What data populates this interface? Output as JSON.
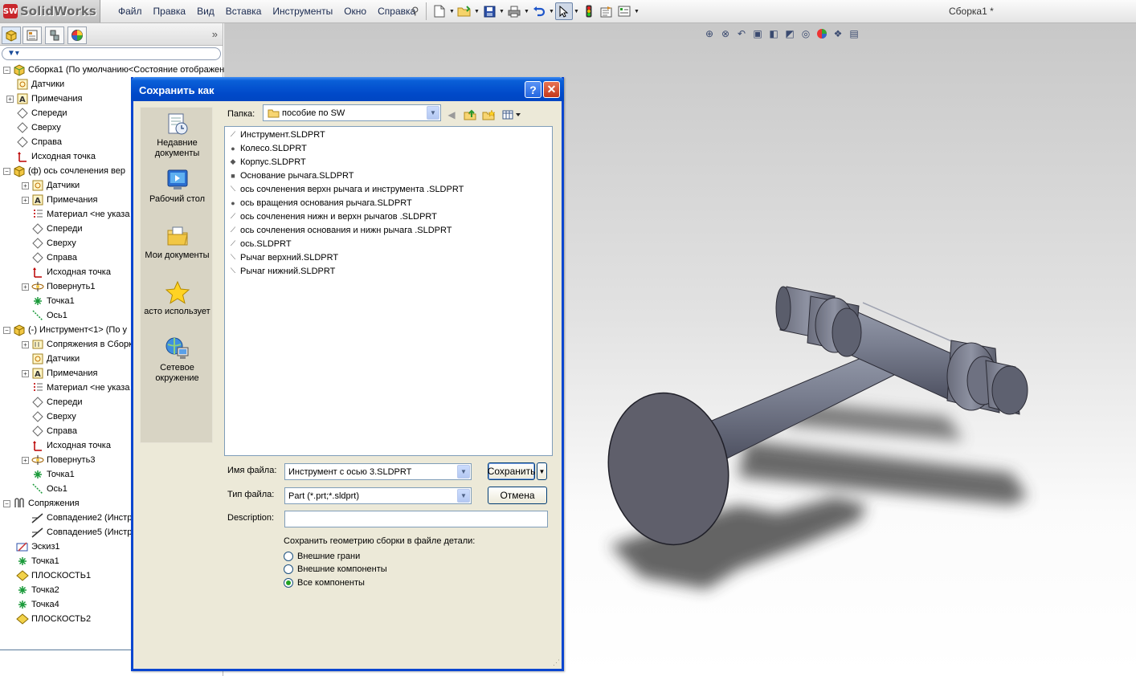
{
  "app": {
    "name": "SolidWorks",
    "logo_mark": "SW",
    "document_title": "Сборка1 *"
  },
  "menu": [
    "Файл",
    "Правка",
    "Вид",
    "Вставка",
    "Инструменты",
    "Окно",
    "Справка"
  ],
  "toolbar_icons": [
    "new-icon",
    "open-icon",
    "save-icon",
    "print-icon",
    "undo-icon",
    "select-icon",
    "rebuild-icon",
    "options-icon",
    "customize-icon"
  ],
  "view_toolbar_icons": [
    "zoom-to-fit-icon",
    "zoom-area-icon",
    "previous-view-icon",
    "section-view-icon",
    "view-orientation-icon",
    "display-style-icon",
    "hide-show-icon",
    "appearance-icon",
    "scene-icon",
    "view-settings-icon"
  ],
  "feature_tree": {
    "items": [
      {
        "label": "Сборка1  (По умолчанию<Состояние отображени",
        "icon": "assembly-icon"
      },
      {
        "label": "Датчики",
        "icon": "sensor-icon"
      },
      {
        "label": "Примечания",
        "icon": "annotation-icon"
      },
      {
        "label": "Спереди",
        "icon": "plane-icon"
      },
      {
        "label": "Сверху",
        "icon": "plane-icon"
      },
      {
        "label": "Справа",
        "icon": "plane-icon"
      },
      {
        "label": "Исходная точка",
        "icon": "origin-icon"
      },
      {
        "label": "(ф) ось  сочленения вер",
        "icon": "part-icon"
      },
      {
        "label": "Датчики",
        "icon": "sensor-icon"
      },
      {
        "label": "Примечания",
        "icon": "annotation-icon"
      },
      {
        "label": "Материал <не указа",
        "icon": "material-icon"
      },
      {
        "label": "Спереди",
        "icon": "plane-icon"
      },
      {
        "label": "Сверху",
        "icon": "plane-icon"
      },
      {
        "label": "Справа",
        "icon": "plane-icon"
      },
      {
        "label": "Исходная точка",
        "icon": "origin-icon"
      },
      {
        "label": "Повернуть1",
        "icon": "revolve-icon"
      },
      {
        "label": "Точка1",
        "icon": "point-icon"
      },
      {
        "label": "Ось1",
        "icon": "axis-icon"
      },
      {
        "label": "(-) Инструмент<1> (По у",
        "icon": "part-icon"
      },
      {
        "label": "Сопряжения в Сборк",
        "icon": "mates-folder-icon"
      },
      {
        "label": "Датчики",
        "icon": "sensor-icon"
      },
      {
        "label": "Примечания",
        "icon": "annotation-icon"
      },
      {
        "label": "Материал <не указа",
        "icon": "material-icon"
      },
      {
        "label": "Спереди",
        "icon": "plane-icon"
      },
      {
        "label": "Сверху",
        "icon": "plane-icon"
      },
      {
        "label": "Справа",
        "icon": "plane-icon"
      },
      {
        "label": "Исходная точка",
        "icon": "origin-icon"
      },
      {
        "label": "Повернуть3",
        "icon": "revolve-icon"
      },
      {
        "label": "Точка1",
        "icon": "point-icon"
      },
      {
        "label": "Ось1",
        "icon": "axis-icon"
      },
      {
        "label": "Сопряжения",
        "icon": "mates-icon"
      },
      {
        "label": "Совпадение2 (Инстр",
        "icon": "coincident-icon"
      },
      {
        "label": "Совпадение5 (Инстр",
        "icon": "coincident-icon"
      },
      {
        "label": "Эскиз1",
        "icon": "sketch-icon"
      },
      {
        "label": "Точка1",
        "icon": "point-icon"
      },
      {
        "label": "ПЛОСКОСТЬ1",
        "icon": "plane-feature-icon"
      },
      {
        "label": "Точка2",
        "icon": "point-icon"
      },
      {
        "label": "Точка4",
        "icon": "point-icon"
      },
      {
        "label": "ПЛОСКОСТЬ2",
        "icon": "plane-feature-icon"
      }
    ]
  },
  "dialog": {
    "title": "Сохранить как",
    "help_label": "?",
    "close_label": "✕",
    "places": [
      {
        "label": "Недавние документы",
        "icon": "recent-documents-icon"
      },
      {
        "label": "Рабочий стол",
        "icon": "desktop-icon"
      },
      {
        "label": "Мои документы",
        "icon": "my-documents-icon"
      },
      {
        "label": "асто использует",
        "icon": "favorites-icon"
      },
      {
        "label": "Сетевое окружение",
        "icon": "network-icon"
      }
    ],
    "folder_label": "Папка:",
    "folder_value": "пособие по SW",
    "files": [
      {
        "name": "Инструмент.SLDPRT",
        "icon": "part-file-icon"
      },
      {
        "name": "Колесо.SLDPRT",
        "icon": "part-file-icon"
      },
      {
        "name": "Корпус.SLDPRT",
        "icon": "part-file-icon"
      },
      {
        "name": "Основание рычага.SLDPRT",
        "icon": "part-file-icon"
      },
      {
        "name": "ось  сочленения верхн рычага и инструмента .SLDPRT",
        "icon": "part-file-icon"
      },
      {
        "name": "ось вращения основания рычага.SLDPRT",
        "icon": "part-file-icon"
      },
      {
        "name": "ось сочленения нижн и верхн рычагов .SLDPRT",
        "icon": "part-file-icon"
      },
      {
        "name": "ось сочленения основания и нижн рычага .SLDPRT",
        "icon": "part-file-icon"
      },
      {
        "name": "ось.SLDPRT",
        "icon": "part-file-icon"
      },
      {
        "name": "Рычаг верхний.SLDPRT",
        "icon": "part-file-icon"
      },
      {
        "name": "Рычаг нижний.SLDPRT",
        "icon": "part-file-icon"
      }
    ],
    "filename_label": "Имя файла:",
    "filename_value": "Инструмент с осью 3.SLDPRT",
    "filetype_label": "Тип файла:",
    "filetype_value": "Part (*.prt;*.sldprt)",
    "description_label": "Description:",
    "description_value": "",
    "save_label": "Сохранить",
    "cancel_label": "Отмена",
    "geometry_heading": "Сохранить геометрию сборки в файле детали:",
    "geometry_options": [
      "Внешние грани",
      "Внешние компоненты",
      "Все компоненты"
    ],
    "geometry_selected": "Все компоненты"
  },
  "colors": {
    "dialog_title": "#0049c9",
    "model": "#5f5f6b",
    "selection_highlight": "#cfd8e6"
  }
}
